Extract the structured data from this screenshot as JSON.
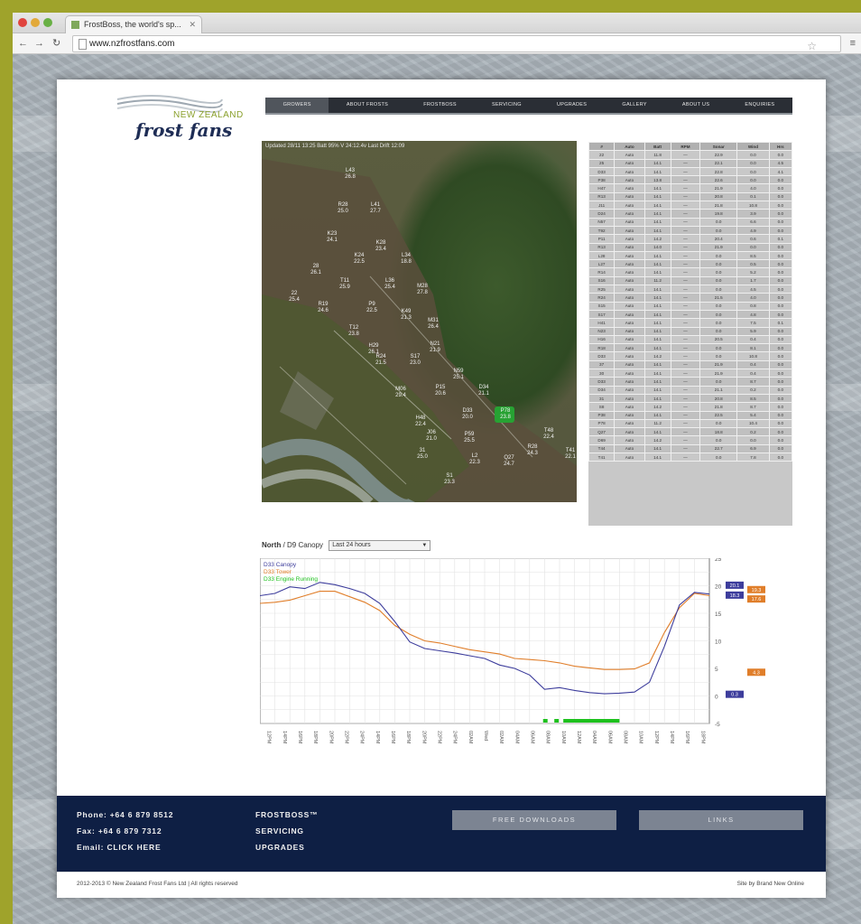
{
  "browser": {
    "tab_title": "FrostBoss, the world's sp...",
    "url": "www.nzfrostfans.com",
    "back_icon": "back-arrow-icon",
    "forward_icon": "forward-arrow-icon",
    "reload_icon": "reload-icon"
  },
  "logo": {
    "top_text": "NEW ZEALAND",
    "main_text": "frost fans"
  },
  "nav": {
    "items": [
      "GROWERS",
      "ABOUT FROSTS",
      "FROSTBOSS",
      "SERVICING",
      "UPGRADES",
      "GALLERY",
      "ABOUT US",
      "ENQUIRIES"
    ],
    "active_index": 0
  },
  "map": {
    "info": "Updated 28/11 13:25  Batt 95% V   24:12.4v   Last Drift 12:09",
    "highlighted_block": "P78",
    "blocks": [
      {
        "id": "L43",
        "val": "26.8"
      },
      {
        "id": "R28",
        "val": "25.0"
      },
      {
        "id": "L41",
        "val": "27.7"
      },
      {
        "id": "K23",
        "val": "24.1"
      },
      {
        "id": "K28",
        "val": "23.4"
      },
      {
        "id": "K24",
        "val": "22.5"
      },
      {
        "id": "L34",
        "val": "18.8"
      },
      {
        "id": "28",
        "val": "26.1"
      },
      {
        "id": "22",
        "val": "25.4"
      },
      {
        "id": "T11",
        "val": "25.9"
      },
      {
        "id": "L36",
        "val": "25.4"
      },
      {
        "id": "M28",
        "val": "27.8"
      },
      {
        "id": "R19",
        "val": "24.6"
      },
      {
        "id": "P9",
        "val": "22.5"
      },
      {
        "id": "T12",
        "val": "23.8"
      },
      {
        "id": "K49",
        "val": "21.3"
      },
      {
        "id": "M31",
        "val": "26.4"
      },
      {
        "id": "H29",
        "val": "26.1"
      },
      {
        "id": "N21",
        "val": "21.9"
      },
      {
        "id": "R24",
        "val": "21.5"
      },
      {
        "id": "S17",
        "val": "23.0"
      },
      {
        "id": "M06",
        "val": "29.4"
      },
      {
        "id": "N59",
        "val": "25.1"
      },
      {
        "id": "P15",
        "val": "20.6"
      },
      {
        "id": "D34",
        "val": "21.1"
      },
      {
        "id": "H48",
        "val": "22.4"
      },
      {
        "id": "D33",
        "val": "20.0"
      },
      {
        "id": "P78",
        "val": "23.8"
      },
      {
        "id": "J06",
        "val": "21.0"
      },
      {
        "id": "P59",
        "val": "25.5"
      },
      {
        "id": "T48",
        "val": "22.4"
      },
      {
        "id": "31",
        "val": "25.0"
      },
      {
        "id": "L2",
        "val": "22.3"
      },
      {
        "id": "Q27",
        "val": "24.7"
      },
      {
        "id": "R28",
        "val": "24.3"
      },
      {
        "id": "T41",
        "val": "22.1"
      },
      {
        "id": "S1",
        "val": "23.3"
      }
    ]
  },
  "table": {
    "headers": [
      "#",
      "Auto",
      "Batt",
      "RPM",
      "Sonar",
      "Wind",
      "Hrs"
    ],
    "rows": [
      [
        "22",
        "Auto",
        "11.8",
        "—",
        "22.9",
        "0.0",
        "0.0"
      ],
      [
        "25",
        "Auto",
        "14.1",
        "—",
        "22.1",
        "0.0",
        "4.5"
      ],
      [
        "D33",
        "Auto",
        "14.1",
        "—",
        "22.8",
        "0.0",
        "4.1"
      ],
      [
        "P38",
        "Auto",
        "13.8",
        "—",
        "22.6",
        "0.0",
        "0.0"
      ],
      [
        "H47",
        "Auto",
        "14.1",
        "—",
        "21.9",
        "4.0",
        "0.0"
      ],
      [
        "R13",
        "Auto",
        "14.1",
        "—",
        "20.8",
        "0.1",
        "0.0"
      ],
      [
        "J11",
        "Auto",
        "14.1",
        "—",
        "21.8",
        "10.8",
        "0.0"
      ],
      [
        "D24",
        "Auto",
        "14.1",
        "—",
        "19.8",
        "3.9",
        "0.0"
      ],
      [
        "N57",
        "Auto",
        "14.1",
        "—",
        "0.0",
        "6.6",
        "0.0"
      ],
      [
        "T92",
        "Auto",
        "14.1",
        "—",
        "0.0",
        "4.9",
        "0.0"
      ],
      [
        "P11",
        "Auto",
        "14.2",
        "—",
        "20.4",
        "0.6",
        "0.1"
      ],
      [
        "R13",
        "Auto",
        "14.0",
        "—",
        "21.9",
        "0.0",
        "0.0"
      ],
      [
        "L28",
        "Auto",
        "14.1",
        "—",
        "0.0",
        "8.5",
        "0.0"
      ],
      [
        "L27",
        "Auto",
        "14.1",
        "—",
        "0.0",
        "0.5",
        "0.0"
      ],
      [
        "R14",
        "Auto",
        "14.1",
        "—",
        "0.0",
        "5.2",
        "0.0"
      ],
      [
        "S16",
        "Auto",
        "11.2",
        "—",
        "0.0",
        "1.7",
        "0.0"
      ],
      [
        "R25",
        "Auto",
        "14.1",
        "—",
        "0.0",
        "4.5",
        "0.0"
      ],
      [
        "R24",
        "Auto",
        "14.1",
        "—",
        "21.5",
        "4.0",
        "0.0"
      ],
      [
        "S15",
        "Auto",
        "14.1",
        "—",
        "0.0",
        "0.8",
        "0.0"
      ],
      [
        "S17",
        "Auto",
        "14.1",
        "—",
        "0.0",
        "4.8",
        "0.0"
      ],
      [
        "H41",
        "Auto",
        "14.1",
        "—",
        "0.0",
        "7.5",
        "0.1"
      ],
      [
        "N23",
        "Auto",
        "14.1",
        "—",
        "0.0",
        "5.9",
        "0.0"
      ],
      [
        "H16",
        "Auto",
        "14.1",
        "—",
        "20.5",
        "0.4",
        "0.0"
      ],
      [
        "R18",
        "Auto",
        "14.1",
        "—",
        "0.0",
        "8.1",
        "0.0"
      ],
      [
        "D33",
        "Auto",
        "14.2",
        "—",
        "0.0",
        "10.8",
        "0.0"
      ],
      [
        "37",
        "Auto",
        "14.1",
        "—",
        "21.9",
        "0.4",
        "0.0"
      ],
      [
        "30",
        "Auto",
        "14.1",
        "—",
        "21.9",
        "0.4",
        "0.0"
      ],
      [
        "D33",
        "Auto",
        "14.1",
        "—",
        "0.0",
        "8.7",
        "0.0"
      ],
      [
        "D34",
        "Auto",
        "14.1",
        "—",
        "21.1",
        "0.2",
        "0.0"
      ],
      [
        "31",
        "Auto",
        "14.1",
        "—",
        "20.8",
        "8.5",
        "0.0"
      ],
      [
        "S8",
        "Auto",
        "14.2",
        "—",
        "21.8",
        "8.7",
        "0.0"
      ],
      [
        "P38",
        "Auto",
        "14.1",
        "—",
        "22.5",
        "5.4",
        "0.0"
      ],
      [
        "P78",
        "Auto",
        "11.2",
        "—",
        "0.0",
        "10.4",
        "0.0"
      ],
      [
        "Q27",
        "Auto",
        "14.1",
        "—",
        "18.8",
        "0.2",
        "0.0"
      ],
      [
        "D69",
        "Auto",
        "14.2",
        "—",
        "0.0",
        "0.0",
        "0.0"
      ],
      [
        "T44",
        "Auto",
        "14.1",
        "—",
        "22.7",
        "6.9",
        "0.0"
      ],
      [
        "T41",
        "Auto",
        "14.1",
        "—",
        "0.0",
        "7.8",
        "0.0"
      ]
    ]
  },
  "chart_controls": {
    "block": "North",
    "sensor": "/ D9 Canopy",
    "range": "Last 24 hours",
    "dropdown_icon": "triangle-down-icon"
  },
  "chart_data": {
    "type": "line",
    "legend": [
      "D33 Canopy",
      "D33 Tower",
      "D33 Engine Running"
    ],
    "colors": {
      "canopy": "#3d3d9c",
      "tower": "#e07e2a",
      "running": "#1ec11e"
    },
    "ylim": [
      -5,
      25
    ],
    "y_ticks": [
      "25",
      "20",
      "15",
      "10",
      "5",
      "0",
      "-5"
    ],
    "x_ticks": [
      "12PM",
      "14PM",
      "16PM",
      "18PM",
      "20PM",
      "22PM",
      "24PM",
      "14PM",
      "16PM",
      "18PM",
      "20PM",
      "22PM",
      "24PM",
      "02AM",
      "Wed",
      "02AM",
      "04AM",
      "06AM",
      "08AM",
      "10AM",
      "12AM",
      "04AM",
      "06AM",
      "08AM",
      "10AM",
      "12PM",
      "14PM",
      "16PM",
      "18PM"
    ],
    "value_badges": [
      {
        "text": "20.1",
        "series": "canopy",
        "level": 20.1
      },
      {
        "text": "18.3",
        "series": "canopy",
        "level": 18.3
      },
      {
        "text": "19.3",
        "series": "tower",
        "level": 19.3
      },
      {
        "text": "17.6",
        "series": "tower",
        "level": 17.6
      },
      {
        "text": "4.3",
        "series": "tower",
        "level": 4.3
      },
      {
        "text": "0.3",
        "series": "canopy",
        "level": 0.3
      }
    ],
    "series": [
      {
        "name": "D33 Canopy",
        "values": [
          18.2,
          18.6,
          19.8,
          19.5,
          20.6,
          20.2,
          19.5,
          18.6,
          16.8,
          13.5,
          9.8,
          8.6,
          8.2,
          7.8,
          7.3,
          6.8,
          5.6,
          5.0,
          3.8,
          1.2,
          1.5,
          1.0,
          0.6,
          0.4,
          0.5,
          0.7,
          2.5,
          9.0,
          16.5,
          18.8,
          18.5
        ]
      },
      {
        "name": "D33 Tower",
        "values": [
          16.8,
          17.0,
          17.4,
          18.2,
          19.0,
          19.0,
          18.0,
          17.0,
          15.5,
          12.8,
          11.2,
          10.0,
          9.6,
          9.0,
          8.4,
          8.0,
          7.6,
          6.8,
          6.6,
          6.4,
          6.0,
          5.4,
          5.1,
          4.8,
          4.8,
          4.9,
          6.0,
          11.5,
          16.0,
          18.6,
          18.2
        ]
      },
      {
        "name": "D33 Engine Running",
        "intervals": [
          [
            0.63,
            0.64
          ],
          [
            0.655,
            0.665
          ],
          [
            0.675,
            0.8
          ]
        ]
      }
    ]
  },
  "footer": {
    "phone": "Phone: +64 6 879 8512",
    "fax": "Fax: +64 6 879 7312",
    "email": "Email: CLICK HERE",
    "links": [
      "FROSTBOSS™",
      "SERVICING",
      "UPGRADES"
    ],
    "downloads_button": "FREE DOWNLOADS",
    "links_button": "LINKS",
    "copyright": "2012-2013 © New Zealand Frost Fans Ltd  |  All rights reserved",
    "credit": "Site by Brand New Online"
  }
}
